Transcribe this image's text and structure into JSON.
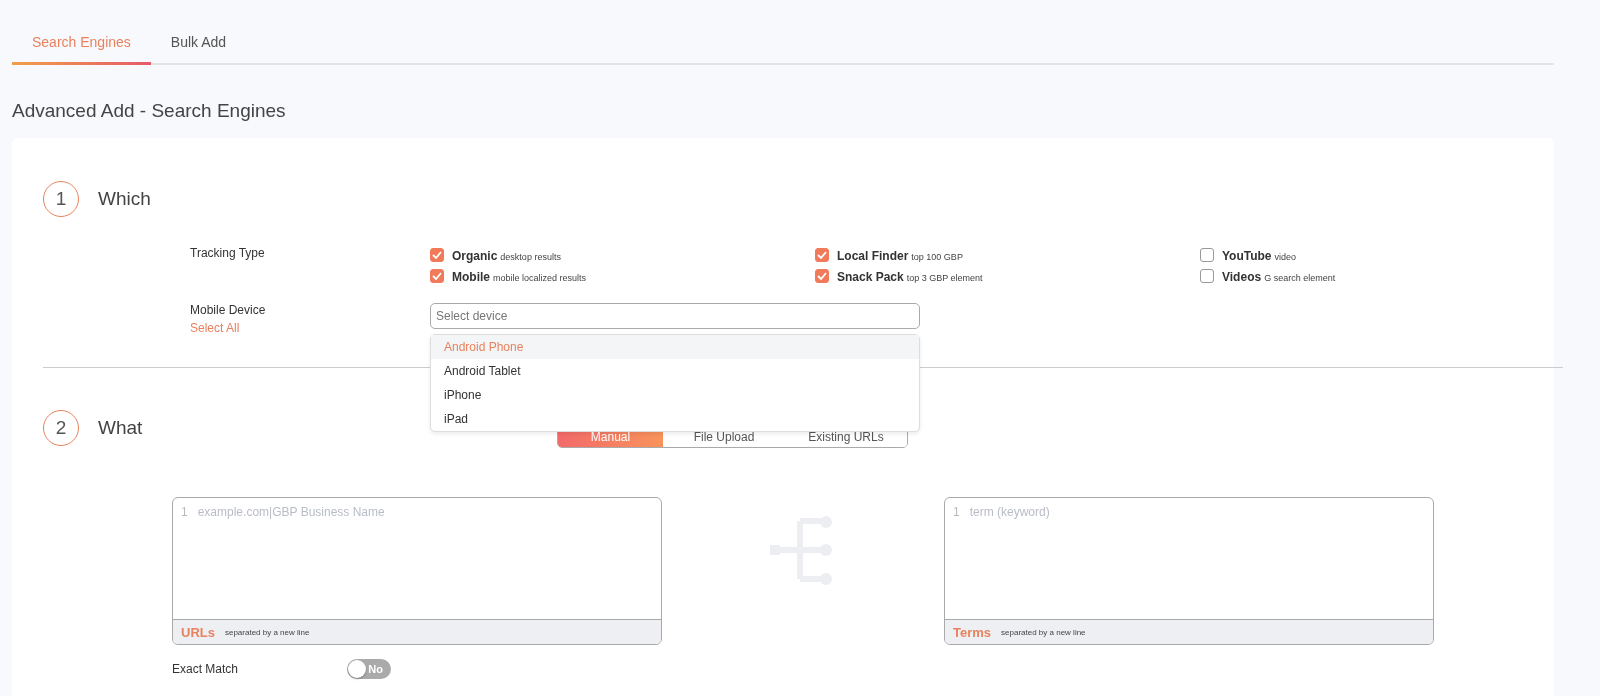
{
  "tabs": [
    {
      "label": "Search Engines",
      "selected": true
    },
    {
      "label": "Bulk Add",
      "selected": false
    }
  ],
  "heading": "Advanced Add - Search Engines",
  "steps": [
    {
      "number": "1",
      "title": "Which"
    },
    {
      "number": "2",
      "title": "What"
    }
  ],
  "tracking_type": {
    "label": "Tracking Type",
    "options": [
      {
        "name": "Organic",
        "note": "desktop results",
        "checked": true
      },
      {
        "name": "Local Finder",
        "note": "top 100 GBP",
        "checked": true
      },
      {
        "name": "YouTube",
        "note": "video",
        "checked": false
      },
      {
        "name": "Mobile",
        "note": "mobile localized results",
        "checked": true
      },
      {
        "name": "Snack Pack",
        "note": "top 3 GBP element",
        "checked": true
      },
      {
        "name": "Videos",
        "note": "G search element",
        "checked": false
      }
    ]
  },
  "mobile_device": {
    "label": "Mobile Device",
    "select_all": "Select All",
    "placeholder": "Select device",
    "options": [
      {
        "label": "Android Phone",
        "selected": true
      },
      {
        "label": "Android Tablet",
        "selected": false
      },
      {
        "label": "iPhone",
        "selected": false
      },
      {
        "label": "iPad",
        "selected": false
      }
    ]
  },
  "source_modes": [
    {
      "label": "Manual",
      "selected": true
    },
    {
      "label": "File Upload",
      "selected": false
    },
    {
      "label": "Existing URLs",
      "selected": false
    }
  ],
  "inputs": [
    {
      "line_number": "1",
      "placeholder": "example.com|GBP Business Name",
      "title": "URLs",
      "hint": "separated by a new line"
    },
    {
      "line_number": "1",
      "placeholder": "term (keyword)",
      "title": "Terms",
      "hint": "separated by a new line"
    }
  ],
  "exact_match": {
    "label": "Exact Match",
    "on": false,
    "state_text": "No"
  }
}
